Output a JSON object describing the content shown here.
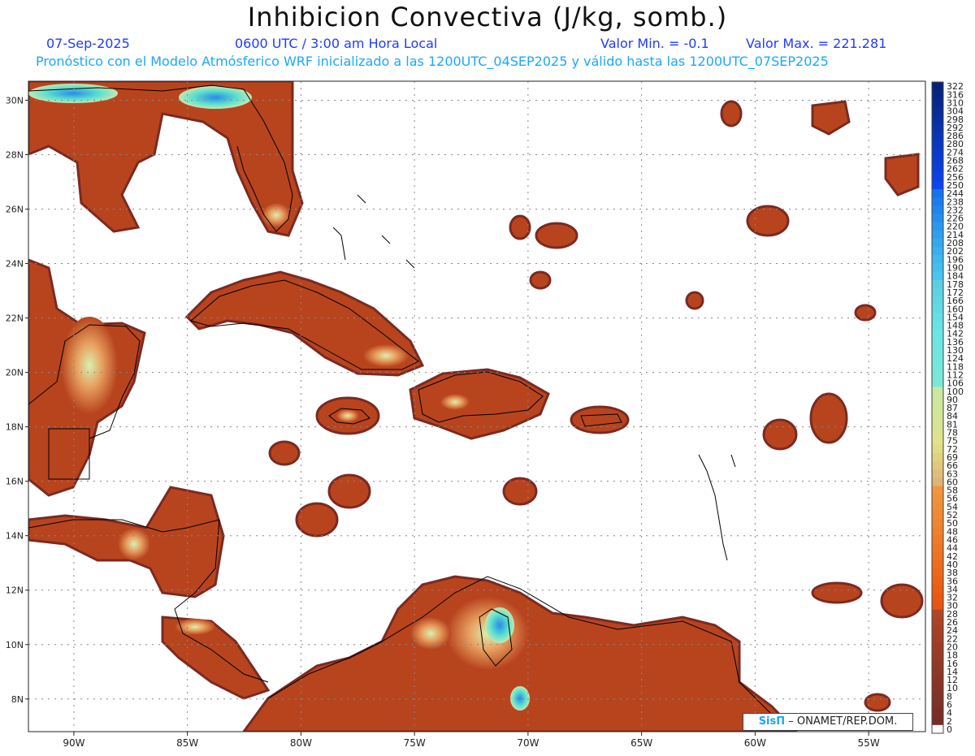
{
  "header": {
    "title": "Inhibicion Convectiva (J/kg, somb.)",
    "date": "07-Sep-2025",
    "time": "0600 UTC / 3:00 am Hora Local",
    "min_label": "Valor Min. = -0.1",
    "max_label": "Valor Max. = 221.281",
    "model_line": "Pronóstico con el Modelo Atmósferico WRF inicializado a las 1200UTC_04SEP2025 y válido hasta las  1200UTC_07SEP2025"
  },
  "map": {
    "lon_range": [
      -92,
      -52.5
    ],
    "lat_range": [
      6.8,
      30.7
    ],
    "lon_ticks": [
      {
        "value": -90,
        "label": "90W"
      },
      {
        "value": -85,
        "label": "85W"
      },
      {
        "value": -80,
        "label": "80W"
      },
      {
        "value": -75,
        "label": "75W"
      },
      {
        "value": -70,
        "label": "70W"
      },
      {
        "value": -65,
        "label": "65W"
      },
      {
        "value": -60,
        "label": "60W"
      },
      {
        "value": -55,
        "label": "55W"
      }
    ],
    "lat_ticks": [
      {
        "value": 8,
        "label": "8N"
      },
      {
        "value": 10,
        "label": "10N"
      },
      {
        "value": 12,
        "label": "12N"
      },
      {
        "value": 14,
        "label": "14N"
      },
      {
        "value": 16,
        "label": "16N"
      },
      {
        "value": 18,
        "label": "18N"
      },
      {
        "value": 20,
        "label": "20N"
      },
      {
        "value": 22,
        "label": "22N"
      },
      {
        "value": 24,
        "label": "24N"
      },
      {
        "value": 26,
        "label": "26N"
      },
      {
        "value": 28,
        "label": "28N"
      },
      {
        "value": 30,
        "label": "30N"
      }
    ],
    "grid": true,
    "colors": {
      "dark": "#7a2a22",
      "mid": "#c04a1e",
      "orange": "#e0702a",
      "light": "#f0c890",
      "cyan": "#5be0d0",
      "blue": "#2a8ae8"
    }
  },
  "colorbar": {
    "labels": [
      "322",
      "316",
      "310",
      "304",
      "298",
      "292",
      "286",
      "280",
      "274",
      "268",
      "262",
      "256",
      "250",
      "244",
      "238",
      "232",
      "226",
      "220",
      "214",
      "208",
      "202",
      "196",
      "190",
      "184",
      "178",
      "172",
      "166",
      "160",
      "154",
      "148",
      "142",
      "136",
      "130",
      "124",
      "118",
      "112",
      "106",
      "100",
      "90",
      "87",
      "84",
      "81",
      "78",
      "75",
      "72",
      "69",
      "66",
      "63",
      "60",
      "58",
      "56",
      "54",
      "52",
      "50",
      "48",
      "46",
      "44",
      "42",
      "40",
      "38",
      "36",
      "34",
      "32",
      "30",
      "28",
      "26",
      "24",
      "22",
      "20",
      "18",
      "16",
      "14",
      "12",
      "10",
      "8",
      "6",
      "4",
      "2",
      "0"
    ]
  },
  "credit": {
    "brand": "SisΠ",
    "text": "– ONAMET/REP.DOM."
  }
}
